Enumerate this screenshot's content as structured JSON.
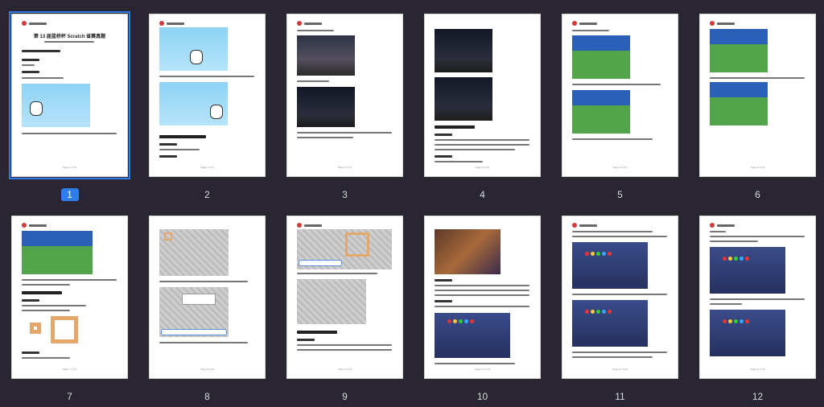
{
  "pages": [
    {
      "number": "1",
      "selected": true,
      "title": "第 13 届蓝桥杯 Scratch 省赛真题",
      "footer": "Page 1 of 13"
    },
    {
      "number": "2",
      "selected": false,
      "title": "",
      "footer": "Page 2 of 13"
    },
    {
      "number": "3",
      "selected": false,
      "title": "",
      "footer": "Page 3 of 13"
    },
    {
      "number": "4",
      "selected": false,
      "title": "",
      "footer": "Page 4 of 13"
    },
    {
      "number": "5",
      "selected": false,
      "title": "",
      "footer": "Page 5 of 13"
    },
    {
      "number": "6",
      "selected": false,
      "title": "",
      "footer": "Page 6 of 13"
    },
    {
      "number": "7",
      "selected": false,
      "title": "",
      "footer": "Page 7 of 13"
    },
    {
      "number": "8",
      "selected": false,
      "title": "",
      "footer": "Page 8 of 13"
    },
    {
      "number": "9",
      "selected": false,
      "title": "",
      "footer": "Page 9 of 13"
    },
    {
      "number": "10",
      "selected": false,
      "title": "",
      "footer": "Page 10 of 13"
    },
    {
      "number": "11",
      "selected": false,
      "title": "",
      "footer": "Page 11 of 13"
    },
    {
      "number": "12",
      "selected": false,
      "title": "",
      "footer": "Page 12 of 13"
    }
  ],
  "colors": {
    "background": "#2a2631",
    "selected_accent": "#2f7de8"
  }
}
